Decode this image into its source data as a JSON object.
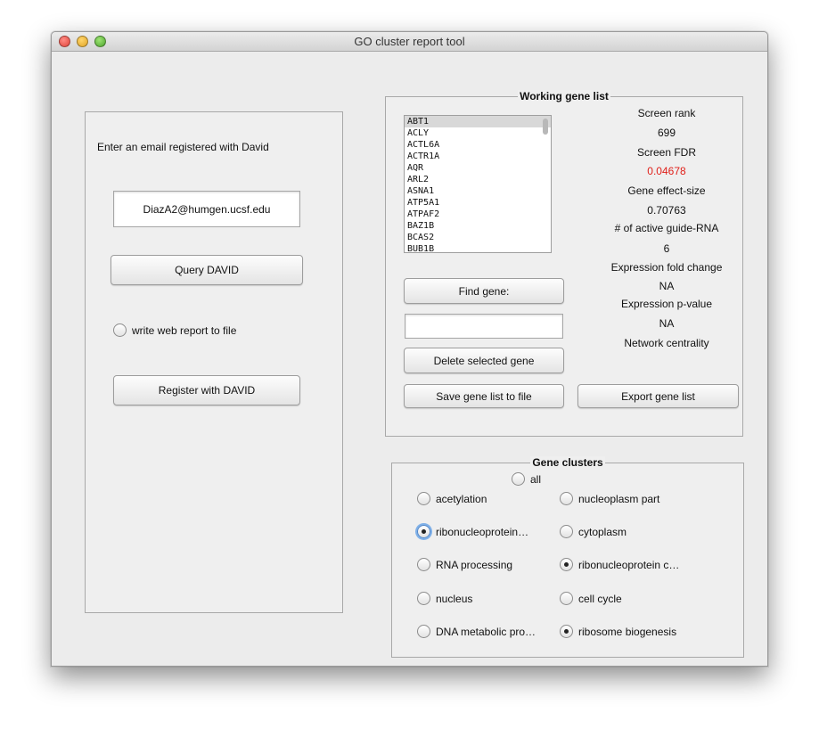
{
  "window": {
    "title": "GO cluster report tool"
  },
  "left": {
    "email_prompt": "Enter an email registered with David",
    "email_value": "DiazA2@humgen.ucsf.edu",
    "query_button": "Query DAVID",
    "write_report_label": "write web report to file",
    "write_report_checked": false,
    "register_button": "Register with DAVID"
  },
  "gene_list": {
    "title": "Working gene list",
    "genes": [
      "ABT1",
      "ACLY",
      "ACTL6A",
      "ACTR1A",
      "AQR",
      "ARL2",
      "ASNA1",
      "ATP5A1",
      "ATPAF2",
      "BAZ1B",
      "BCAS2",
      "BUB1B"
    ],
    "selected": "ABT1",
    "find_button": "Find gene:",
    "find_value": "",
    "delete_button": "Delete selected gene",
    "save_button": "Save gene list to file",
    "export_button": "Export gene list",
    "stats": {
      "screen_rank_label": "Screen rank",
      "screen_rank": "699",
      "screen_fdr_label": "Screen FDR",
      "screen_fdr": "0.04678",
      "effect_label": "Gene effect-size",
      "effect": "0.70763",
      "guides_label": "# of active guide-RNA",
      "guides": "6",
      "fold_label": "Expression fold change",
      "fold": "NA",
      "pval_label": "Expression p-value",
      "pval": "NA",
      "centrality_label": "Network centrality"
    },
    "fdr_color": "#e0201a"
  },
  "clusters": {
    "title": "Gene clusters",
    "all_label": "all",
    "items": [
      {
        "label": "acetylation",
        "checked": false
      },
      {
        "label": "nucleoplasm part",
        "checked": false
      },
      {
        "label": "ribonucleoprotein…",
        "checked": true,
        "focused": true
      },
      {
        "label": "cytoplasm",
        "checked": false
      },
      {
        "label": "RNA processing",
        "checked": false
      },
      {
        "label": "ribonucleoprotein c…",
        "checked": true
      },
      {
        "label": "nucleus",
        "checked": false
      },
      {
        "label": "cell cycle",
        "checked": false
      },
      {
        "label": "DNA metabolic pro…",
        "checked": false
      },
      {
        "label": "ribosome biogenesis",
        "checked": true
      }
    ]
  }
}
